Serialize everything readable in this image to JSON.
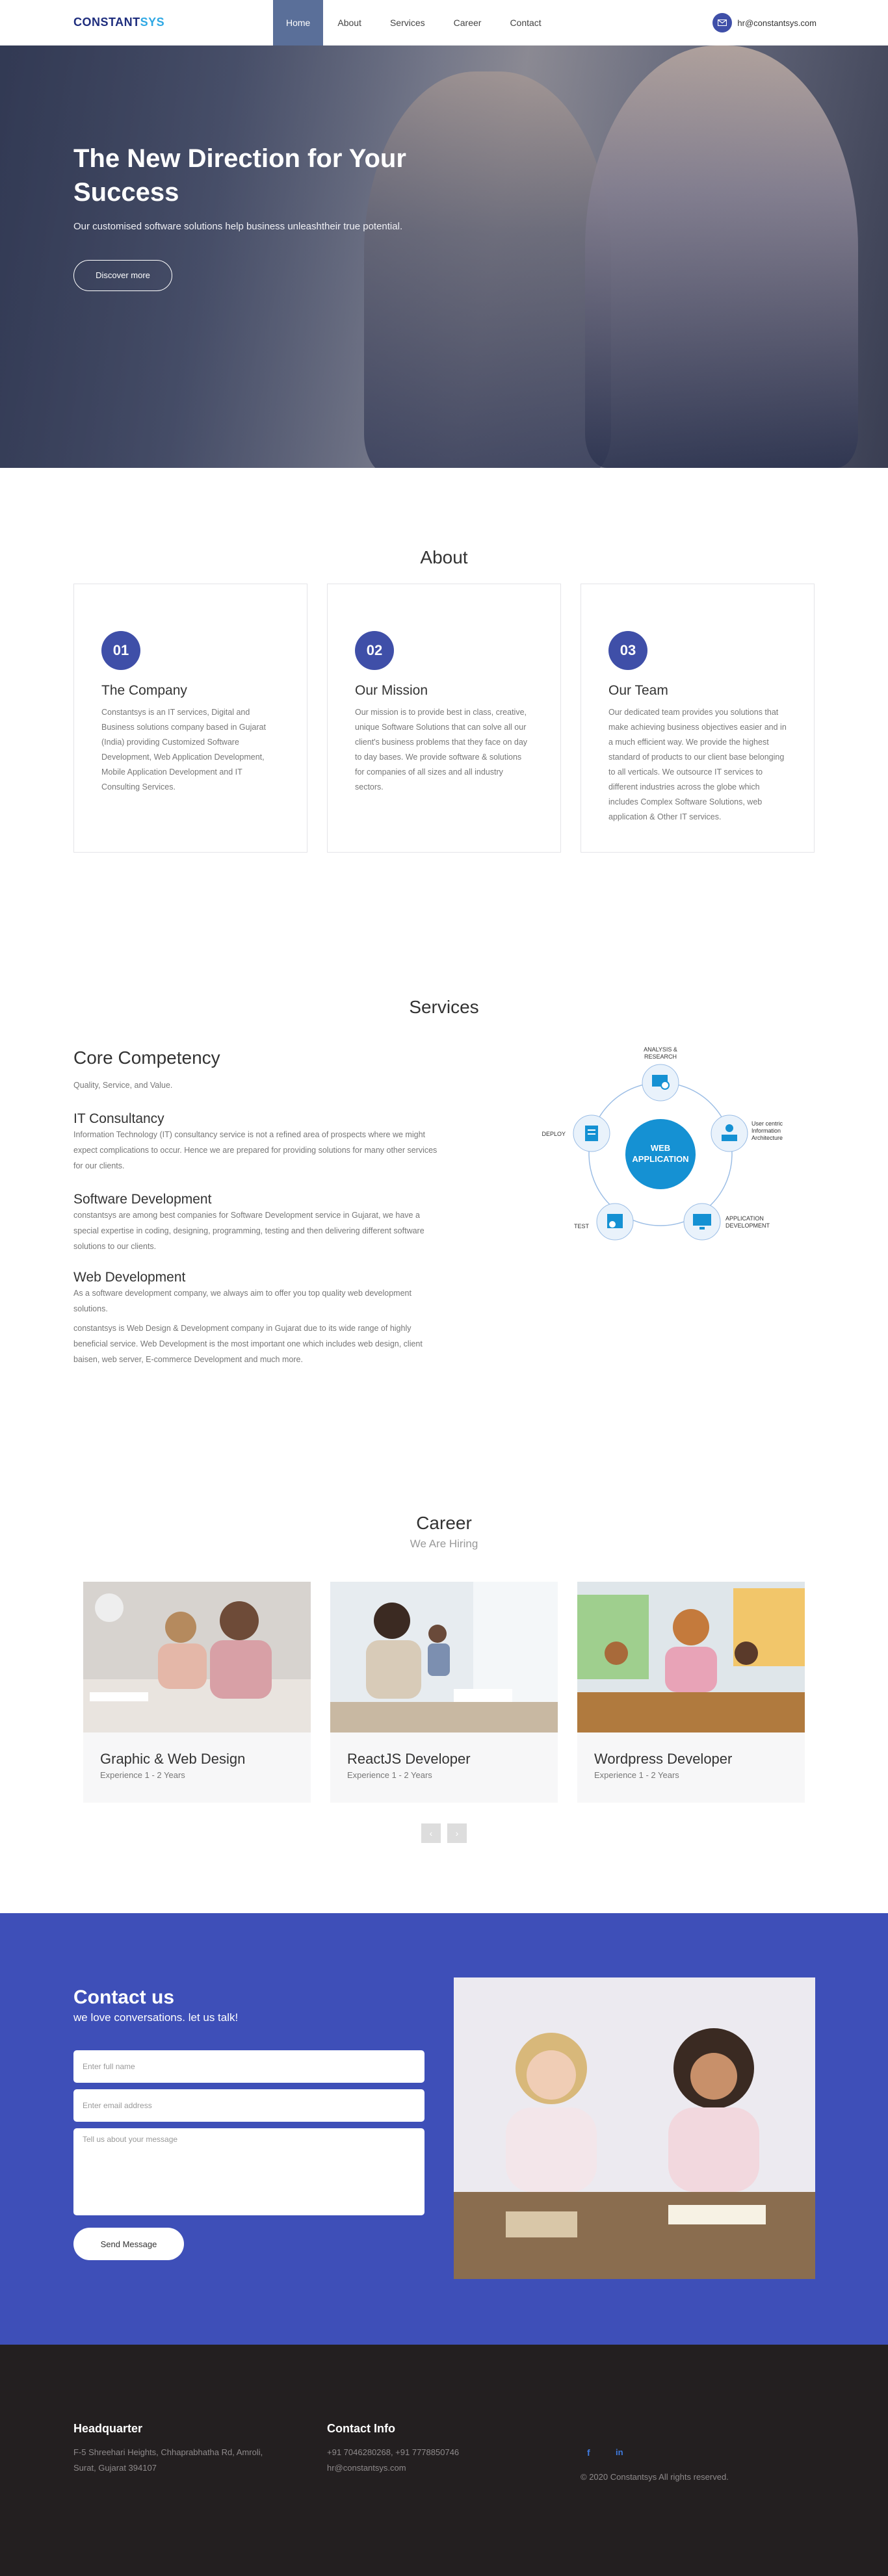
{
  "nav": {
    "logo_main": "CONSTANT",
    "logo_accent": "SYS",
    "items": [
      {
        "label": "Home",
        "active": true
      },
      {
        "label": "About",
        "active": false
      },
      {
        "label": "Services",
        "active": false
      },
      {
        "label": "Career",
        "active": false
      },
      {
        "label": "Contact",
        "active": false
      }
    ],
    "email": "hr@constantsys.com",
    "email_icon": "mail-icon"
  },
  "hero": {
    "title": "The New Direction for Your Success",
    "subtitle": "Our customised software solutions help business unleashtheir true potential.",
    "cta": "Discover more"
  },
  "about": {
    "title": "About",
    "cards": [
      {
        "num": "01",
        "title": "The Company",
        "text": "Constantsys is an IT services, Digital and Business solutions company based in Gujarat (India) providing Customized Software Development, Web Application Development, Mobile Application Development and IT Consulting Services."
      },
      {
        "num": "02",
        "title": "Our Mission",
        "text": "Our mission is to provide best in class, creative, unique Software Solutions that can solve all our client's business problems that they face on day to day bases. We provide software & solutions for companies of all sizes and all industry sectors."
      },
      {
        "num": "03",
        "title": "Our Team",
        "text": "Our dedicated team provides you solutions that make achieving business objectives easier and in a much efficient way. We provide the highest standard of products to our client base belonging to all verticals. We outsource IT services to different industries across the globe which includes Complex Software Solutions, web application & Other IT services."
      }
    ]
  },
  "services": {
    "title": "Services",
    "core_title": "Core Competency",
    "core_sub": "Quality, Service, and Value.",
    "items": [
      {
        "title": "IT Consultancy",
        "text": "Information Technology (IT) consultancy service is not a refined area of prospects where we might expect complications to occur. Hence we are prepared for providing solutions for many other services for our clients."
      },
      {
        "title": "Software Development",
        "text": "constantsys are among best companies for Software Development service in Gujarat, we have a special expertise in coding, designing, programming, testing and then delivering different software solutions to our clients."
      },
      {
        "title": "Web Development",
        "text": "As a software development company, we always aim to offer you top quality web development solutions.",
        "text2": "constantsys is Web Design & Development company in Gujarat due to its wide range of highly beneficial service. Web Development is the most important one which includes web design, client baisen, web server, E-commerce Development and much more."
      }
    ],
    "diagram": {
      "center_line1": "WEB",
      "center_line2": "APPLICATION",
      "stages": [
        {
          "label1": "ANALYSIS &",
          "label2": "RESEARCH",
          "label3": "",
          "icon": "analysis-icon"
        },
        {
          "label1": "User centric",
          "label2": "Information",
          "label3": "Architecture",
          "icon": "architecture-icon"
        },
        {
          "label1": "APPLICATION",
          "label2": "DEVELOPMENT",
          "label3": "",
          "icon": "development-icon"
        },
        {
          "label1": "TEST",
          "label2": "",
          "label3": "",
          "icon": "test-icon"
        },
        {
          "label1": "DEPLOY",
          "label2": "",
          "label3": "",
          "icon": "deploy-icon"
        }
      ]
    }
  },
  "career": {
    "title": "Career",
    "subtitle": "We Are Hiring",
    "jobs": [
      {
        "title": "Graphic & Web Design",
        "experience": "Experience 1 - 2 Years"
      },
      {
        "title": "ReactJS Developer",
        "experience": "Experience 1 - 2 Years"
      },
      {
        "title": "Wordpress Developer",
        "experience": "Experience 1 - 2 Years"
      }
    ],
    "prev": "‹",
    "next": "›"
  },
  "contact": {
    "title": "Contact us",
    "subtitle": "we love conversations. let us talk!",
    "name_placeholder": "Enter full name",
    "email_placeholder": "Enter email address",
    "message_placeholder": "Tell us about your message",
    "send": "Send Message"
  },
  "footer": {
    "hq_title": "Headquarter",
    "hq_line1": "F-5 Shreehari Heights, Chhaprabhatha Rd, Amroli,",
    "hq_line2": "Surat, Gujarat 394107",
    "contact_title": "Contact Info",
    "phones": "+91 7046280268, +91 7778850746",
    "email": "hr@constantsys.com",
    "copyright": "© 2020 Constantsys All rights reserved.",
    "social": [
      "facebook-icon",
      "linkedin-icon"
    ]
  }
}
